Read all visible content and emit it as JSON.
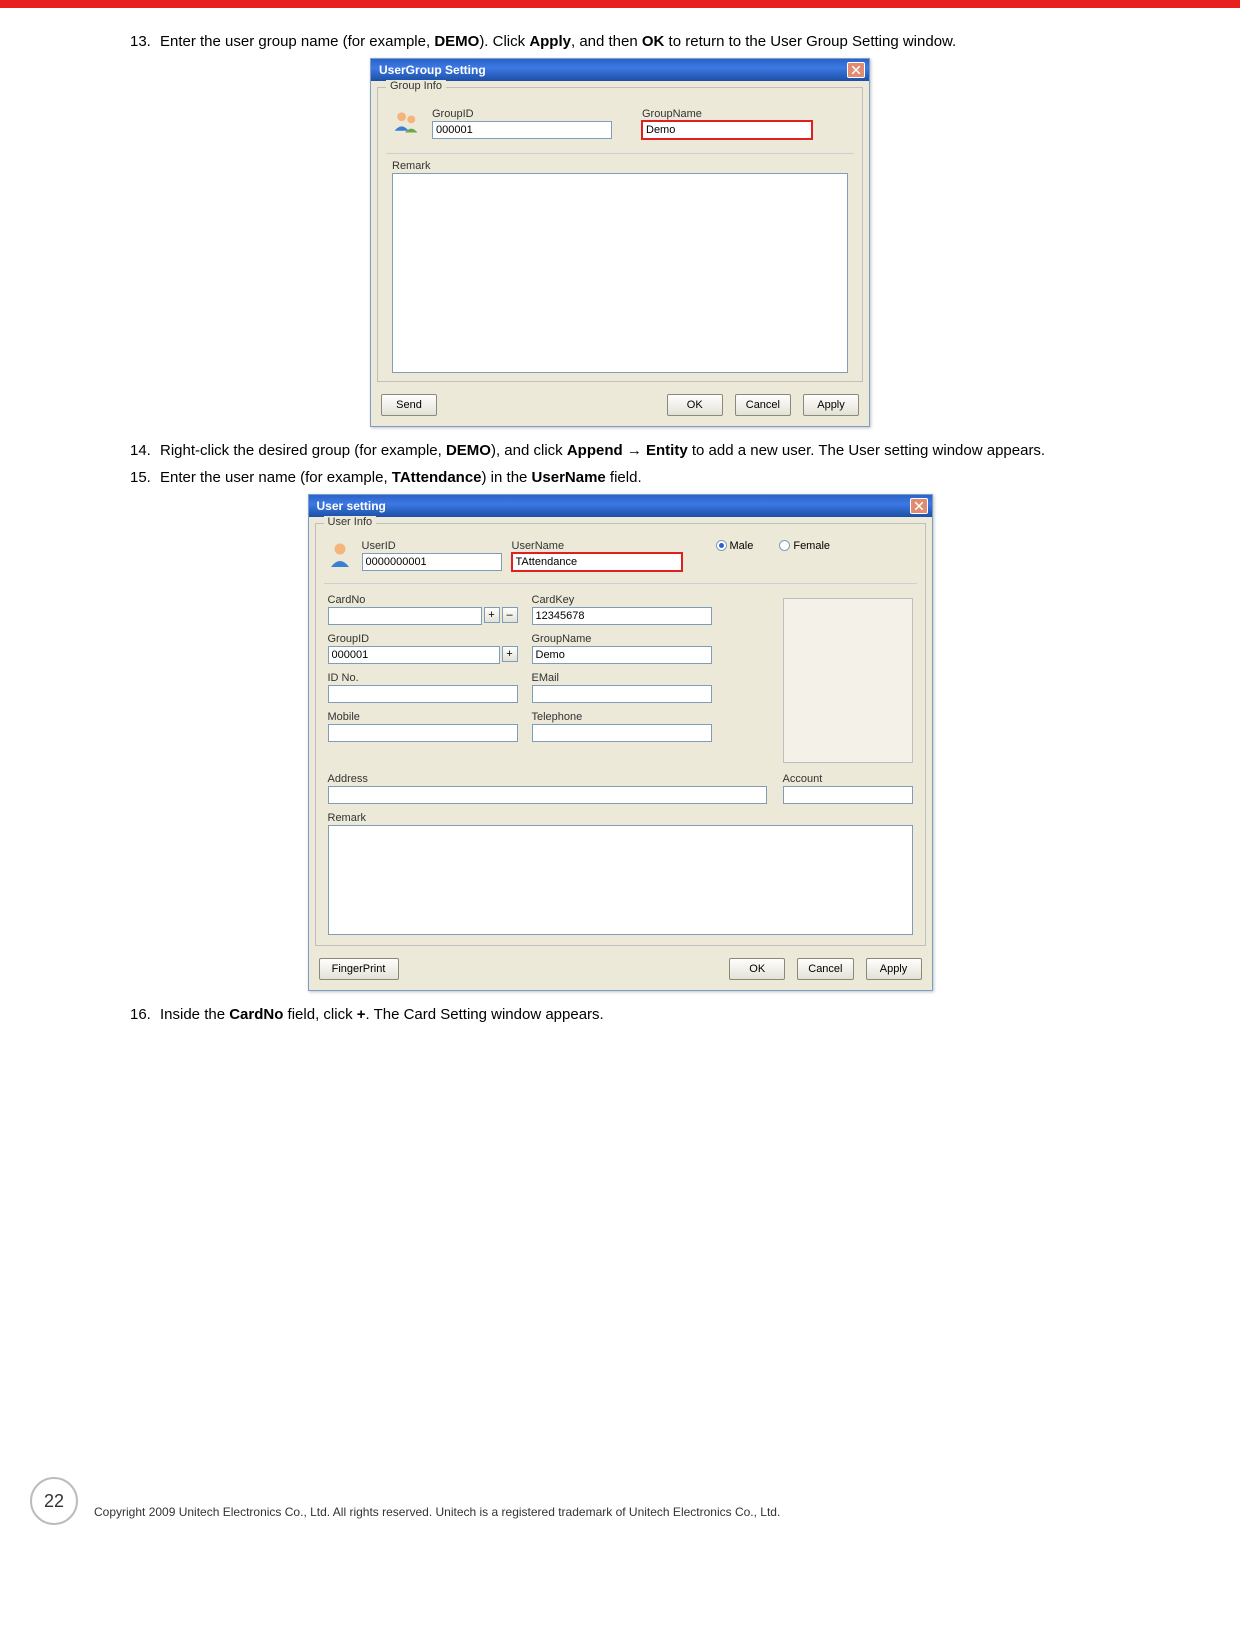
{
  "steps": {
    "s13_num": "13.",
    "s13_a": "Enter the user group name (for example, ",
    "s13_b": "DEMO",
    "s13_c": "). Click ",
    "s13_d": "Apply",
    "s13_e": ", and then ",
    "s13_f": "OK",
    "s13_g": " to return to the User Group Setting window.",
    "s14_num": "14.",
    "s14_a": "Right-click the desired group  (for example, ",
    "s14_b": "DEMO",
    "s14_c": "), and click ",
    "s14_d": "Append",
    "s14_e": " → ",
    "s14_f": "Entity",
    "s14_g": " to add a new user. The User setting window appears.",
    "s15_num": "15.",
    "s15_a": "Enter the user name (for example, ",
    "s15_b": "TAttendance",
    "s15_c": ") in the ",
    "s15_d": "UserName",
    "s15_e": " field.",
    "s16_num": "16.",
    "s16_a": "Inside the ",
    "s16_b": "CardNo",
    "s16_c": " field, click ",
    "s16_d": "+",
    "s16_e": ". The Card Setting window appears."
  },
  "dlg1": {
    "title": "UserGroup Setting",
    "legend": "Group Info",
    "groupid_label": "GroupID",
    "groupid_value": "000001",
    "groupname_label": "GroupName",
    "groupname_value": "Demo",
    "remark_label": "Remark",
    "btn_send": "Send",
    "btn_ok": "OK",
    "btn_cancel": "Cancel",
    "btn_apply": "Apply"
  },
  "dlg2": {
    "title": "User setting",
    "legend": "User Info",
    "userid_label": "UserID",
    "userid_value": "0000000001",
    "username_label": "UserName",
    "username_value": "TAttendance",
    "male_label": "Male",
    "female_label": "Female",
    "cardno_label": "CardNo",
    "cardkey_label": "CardKey",
    "cardkey_value": "12345678",
    "groupid_label": "GroupID",
    "groupid_value": "000001",
    "groupname_label": "GroupName",
    "groupname_value": "Demo",
    "idno_label": "ID No.",
    "email_label": "EMail",
    "mobile_label": "Mobile",
    "telephone_label": "Telephone",
    "address_label": "Address",
    "account_label": "Account",
    "remark_label": "Remark",
    "btn_fp": "FingerPrint",
    "btn_ok": "OK",
    "btn_cancel": "Cancel",
    "btn_apply": "Apply",
    "plus": "+",
    "minus": "–"
  },
  "page_number": "22",
  "copyright": "Copyright 2009 Unitech Electronics Co., Ltd. All rights reserved. Unitech is a registered trademark of Unitech Electronics Co., Ltd."
}
